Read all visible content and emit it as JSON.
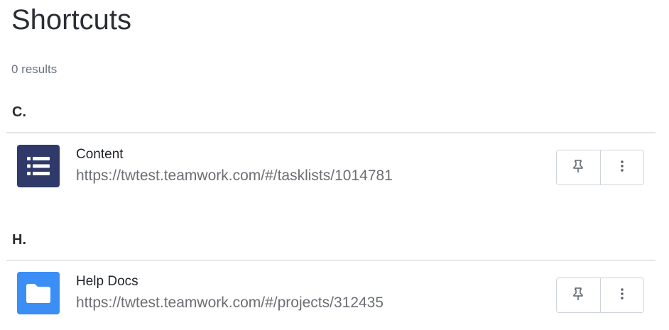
{
  "page": {
    "title": "Shortcuts",
    "results_count": "0 results"
  },
  "groups": [
    {
      "letter": "C.",
      "items": [
        {
          "name": "Content",
          "url": "https://twtest.teamwork.com/#/tasklists/1014781",
          "icon": "tasklist-icon",
          "icon_color": "#2f3a6b"
        }
      ]
    },
    {
      "letter": "H.",
      "items": [
        {
          "name": "Help Docs",
          "url": "https://twtest.teamwork.com/#/projects/312435",
          "icon": "folder-icon",
          "icon_color": "#3a8ef6"
        }
      ]
    }
  ],
  "actions": {
    "pin_icon": "pin-icon",
    "more_icon": "more-vertical-icon"
  },
  "colors": {
    "divider": "#e3e6ea",
    "muted_text": "#6b6f74",
    "button_border": "#cfd4da"
  }
}
